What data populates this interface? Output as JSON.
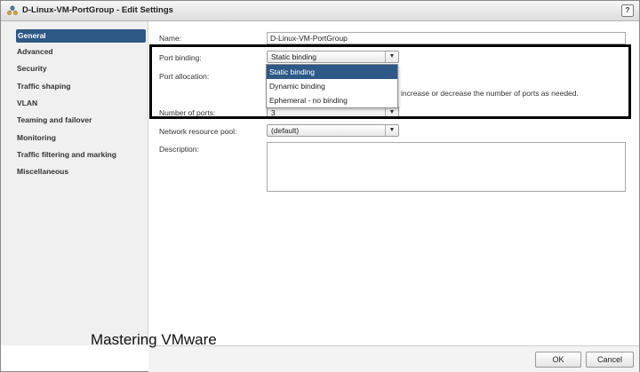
{
  "window": {
    "title": "D-Linux-VM-PortGroup - Edit Settings",
    "help_label": "?"
  },
  "sidebar": {
    "items": [
      {
        "label": "General"
      },
      {
        "label": "Advanced"
      },
      {
        "label": "Security"
      },
      {
        "label": "Traffic shaping"
      },
      {
        "label": "VLAN"
      },
      {
        "label": "Teaming and failover"
      },
      {
        "label": "Monitoring"
      },
      {
        "label": "Traffic filtering and marking"
      },
      {
        "label": "Miscellaneous"
      }
    ],
    "active_item": "General"
  },
  "form": {
    "name": {
      "label": "Name:",
      "value": "D-Linux-VM-PortGroup"
    },
    "port_binding": {
      "label": "Port binding:",
      "value": "Static binding",
      "options": [
        "Static binding",
        "Dynamic binding",
        "Ephemeral - no binding"
      ]
    },
    "port_allocation": {
      "label": "Port allocation:",
      "hint": "increase or decrease the number of ports as needed."
    },
    "number_of_ports": {
      "label": "Number of ports:",
      "value": "3"
    },
    "network_resource_pool": {
      "label": "Network resource pool:",
      "value": "(default)"
    },
    "description": {
      "label": "Description:",
      "value": ""
    }
  },
  "footer": {
    "ok_label": "OK",
    "cancel_label": "Cancel"
  },
  "watermark": "Mastering VMware",
  "colors": {
    "accent": "#2e5886",
    "sidebar_bg": "#f0f0f0",
    "highlight_border": "#000000"
  }
}
